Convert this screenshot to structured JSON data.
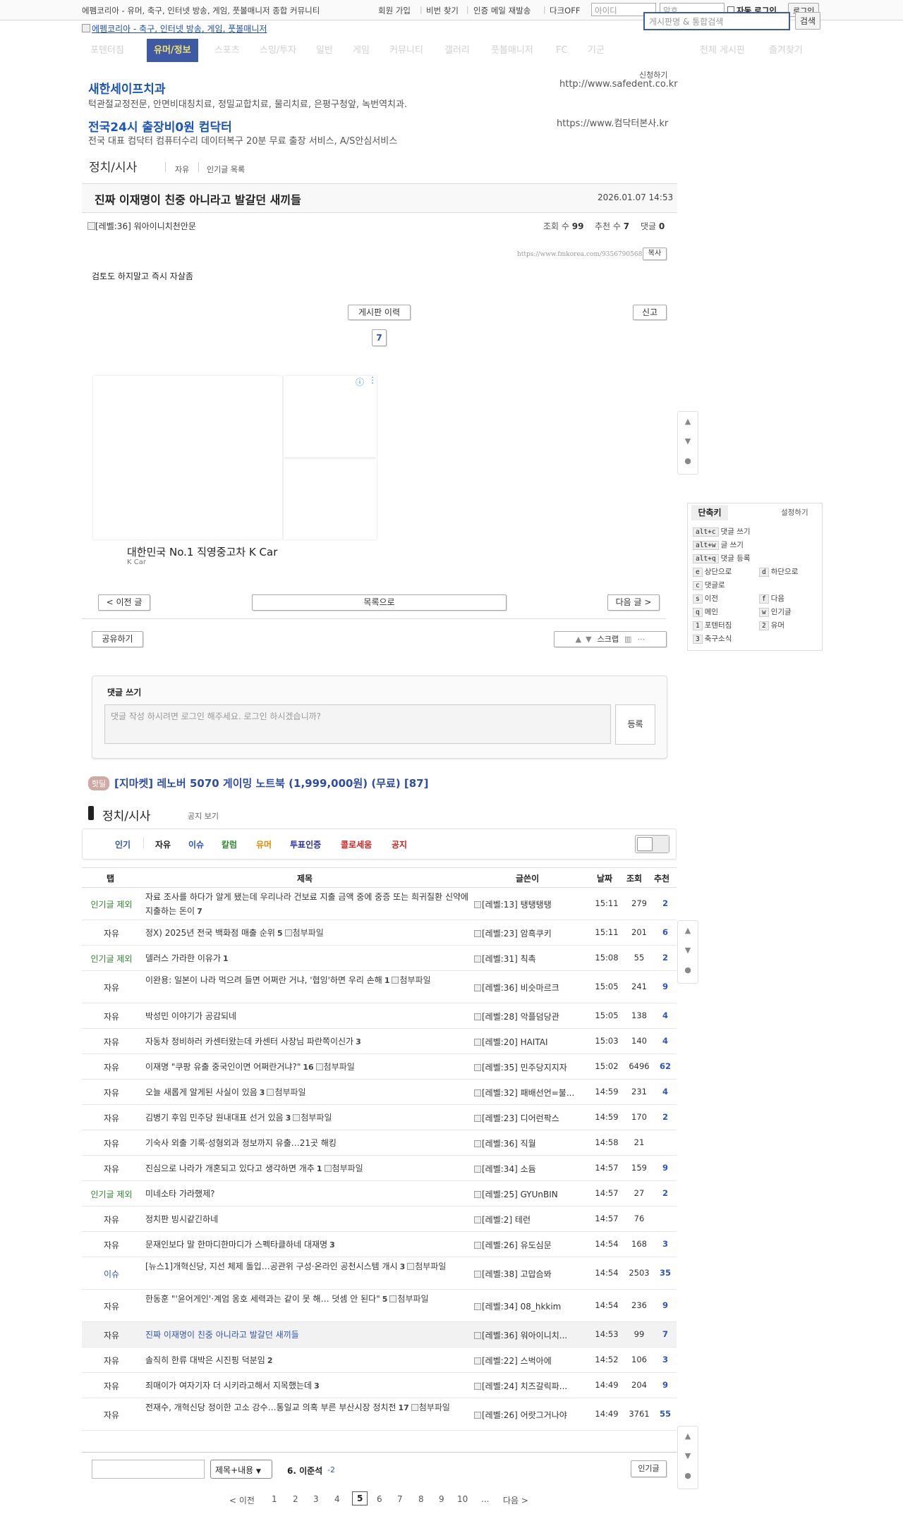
{
  "topbar": {
    "site_desc": "에펨코리아 - 유머, 축구, 인터넷 방송, 게임, 풋볼매니저 종합 커뮤니티",
    "links": [
      "회원 가입",
      "비번 찾기",
      "인증 메일 재발송",
      "다크OFF"
    ],
    "id_placeholder": "아이디",
    "pw_placeholder": "암호",
    "auto_login": "자동 로그인",
    "login": "로그인",
    "search_placeholder": "게시판명 & 통합검색",
    "search": "검색"
  },
  "logo_alt": "에펨코리아 - 축구, 인터넷 방송, 게임, 풋볼매니저",
  "nav": {
    "items": [
      "포텐터짐",
      "유머/정보",
      "스포츠",
      "스밍/투자",
      "일반",
      "게임",
      "커뮤니티",
      "갤러리",
      "풋볼매니저",
      "FC",
      "기군"
    ],
    "active": "유머/정보",
    "right": [
      "전체 게시판",
      "즐겨찾기"
    ]
  },
  "ads": {
    "apply": "신청하기",
    "items": [
      {
        "title": "새한세이프치과",
        "desc": "턱관절교정전문, 안면비대칭치료, 정밀교합치료, 물리치료, 은평구청앞, 녹번역치과.",
        "url": "http://www.safedent.co.kr"
      },
      {
        "title": "전국24시 출장비0원 컴닥터",
        "desc": "전국 대표 컴닥터 컴퓨터수리 데이터복구 20분 무료 출장 서비스, A/S안심서비스",
        "url": "https://www.컴닥터본사.kr"
      }
    ]
  },
  "board": {
    "title": "정치/시사",
    "subs": [
      "자유",
      "인기글 목록"
    ]
  },
  "article": {
    "title": "진짜 이재명이 친중 아니라고 발갈던 새끼들",
    "date": "2026.01.07 14:53",
    "author": "[레벨:36] 워아이니치천안문",
    "views_label": "조회 수",
    "views": "99",
    "votes_label": "추천 수",
    "votes": "7",
    "comments_label": "댓글",
    "comments": "0",
    "url": "https://www.fmkorea.com/9356790568",
    "copy": "복사",
    "body": "검토도 하지말고 즉시 자살좀",
    "history": "게시판 이력",
    "report": "신고",
    "vote_count": "7"
  },
  "sponsored": {
    "title": "대한민국 No.1 직영중고차 K Car",
    "brand": "K Car",
    "info_icon": "ⓘ"
  },
  "article_nav": {
    "prev": "< 이전 글",
    "list": "목록으로",
    "next": "다음 글 >",
    "share": "공유하기",
    "scrap": "스크랩"
  },
  "shortcuts": {
    "title": "단축키",
    "settings": "설정하기",
    "items": [
      {
        "k": "alt+c",
        "l": "댓글 쓰기"
      },
      {
        "k": "alt+w",
        "l": "글 쓰기"
      },
      {
        "k": "alt+q",
        "l": "댓글 등록"
      },
      {
        "k": "e",
        "l": "상단으로"
      },
      {
        "k": "d",
        "l": "하단으로"
      },
      {
        "k": "c",
        "l": "댓글로"
      },
      {
        "k": "s",
        "l": "이전"
      },
      {
        "k": "f",
        "l": "다음"
      },
      {
        "k": "q",
        "l": "메인"
      },
      {
        "k": "w",
        "l": "인기글"
      },
      {
        "k": "1",
        "l": "포텐터짐"
      },
      {
        "k": "2",
        "l": "유머"
      },
      {
        "k": "3",
        "l": "축구소식"
      }
    ]
  },
  "comment": {
    "title": "댓글 쓰기",
    "placeholder": "댓글 작성 하시려면 로그인 해주세요. 로그인 하시겠습니까?",
    "submit": "등록"
  },
  "hotdeal": {
    "badge": "핫딜",
    "text": "[지마켓] 레노버 5070 게이밍 노트북 (1,999,000원) (무료) [87]"
  },
  "list": {
    "title": "정치/시사",
    "notice_toggle": "공지 보기",
    "categories": [
      {
        "label": "인기",
        "color": "#2d55b5"
      },
      {
        "label": "자유",
        "color": "#222222"
      },
      {
        "label": "이슈",
        "color": "#2d55b5"
      },
      {
        "label": "칼럼",
        "color": "#2e8b2e"
      },
      {
        "label": "유머",
        "color": "#e08a00"
      },
      {
        "label": "투표인증",
        "color": "#2d2da0"
      },
      {
        "label": "콜로세움",
        "color": "#d02020"
      },
      {
        "label": "공지",
        "color": "#d02020"
      }
    ],
    "headers": [
      "탭",
      "제목",
      "글쓴이",
      "날짜",
      "조회",
      "추천"
    ],
    "attach_alt": "첨부파일",
    "rows": [
      {
        "cat": "인기글 제외",
        "title": "자료 조사를 하다가 알게 됐는데 우리나라 건보료 지출 금액 중에 중증 또는 희귀질환 신약에 지출하는 돈이",
        "cc": "7",
        "attach": false,
        "author": "[레벨:13] 탱탱탱탱",
        "time": "15:11",
        "views": "279",
        "votes": "2"
      },
      {
        "cat": "자유",
        "title": "정X) 2025년 전국 백화점 매출 순위",
        "cc": "5",
        "attach": true,
        "author": "[레벨:23] 암흑쿠키",
        "time": "15:11",
        "views": "201",
        "votes": "6"
      },
      {
        "cat": "인기글 제외",
        "title": "델러스 가라한 이유가",
        "cc": "1",
        "attach": false,
        "author": "[레벨:31] 칙촉",
        "time": "15:08",
        "views": "55",
        "votes": "2"
      },
      {
        "cat": "자유",
        "title": "이완용: 일본이 나라 먹으려 들면 어쩌란 거냐, '협잉'하면 우리 손해",
        "cc": "1",
        "attach": true,
        "author": "[레벨:36] 비슷마르크",
        "time": "15:05",
        "views": "241",
        "votes": "9"
      },
      {
        "cat": "자유",
        "title": "박성민 이야기가 공감되네",
        "cc": "",
        "attach": false,
        "author": "[레벨:28] 악플덤당관",
        "time": "15:05",
        "views": "138",
        "votes": "4"
      },
      {
        "cat": "자유",
        "title": "자동차 정비하러 카센터왔는데 카센터 사장님 파란쪽이신가",
        "cc": "3",
        "attach": false,
        "author": "[레벨:20] HAITAI",
        "time": "15:03",
        "views": "140",
        "votes": "4"
      },
      {
        "cat": "자유",
        "title": "이재명 \"쿠팡 유출 중국인이면 어쩌란거냐?\"",
        "cc": "16",
        "attach": true,
        "author": "[레벨:35] 민주당지지자",
        "time": "15:02",
        "views": "6496",
        "votes": "62"
      },
      {
        "cat": "자유",
        "title": "오늘 새롭게 알게된 사실이 있음",
        "cc": "3",
        "attach": true,
        "author": "[레벨:32] 패배선언=불...",
        "time": "14:59",
        "views": "231",
        "votes": "4"
      },
      {
        "cat": "자유",
        "title": "김병기 후임 민주당 원내대표 선거 있음",
        "cc": "3",
        "attach": true,
        "author": "[레벨:23] 디어런팍스",
        "time": "14:59",
        "views": "170",
        "votes": "2"
      },
      {
        "cat": "자유",
        "title": "기숙사 외출 기록·성형외과 정보까지 유출…21곳 해킹",
        "cc": "",
        "attach": false,
        "author": "[레벨:36] 직월",
        "time": "14:58",
        "views": "21",
        "votes": ""
      },
      {
        "cat": "자유",
        "title": "진심으로 나라가 개혼되고 있다고 생각하면 개추",
        "cc": "1",
        "attach": true,
        "author": "[레벨:34] 소듐",
        "time": "14:57",
        "views": "159",
        "votes": "9"
      },
      {
        "cat": "인기글 제외",
        "title": "미네소타 가라했제?",
        "cc": "",
        "attach": false,
        "author": "[레벨:25] GYUnBIN",
        "time": "14:57",
        "views": "27",
        "votes": "2"
      },
      {
        "cat": "자유",
        "title": "정치판 빙시같긴하네",
        "cc": "",
        "attach": false,
        "author": "[레벨:2] 테런",
        "time": "14:57",
        "views": "76",
        "votes": ""
      },
      {
        "cat": "자유",
        "title": "문재인보다 말 한마디한마디가 스펙타클하네 대재명",
        "cc": "3",
        "attach": false,
        "author": "[레벨:26] 유도심문",
        "time": "14:54",
        "views": "168",
        "votes": "3"
      },
      {
        "cat": "이슈",
        "title": "[뉴스1]개혁신당, 지선 체제 돌입…공관위 구성·온라인 공천시스템 개시",
        "cc": "3",
        "attach": true,
        "author": "[레벨:38] 고맙슴봐",
        "time": "14:54",
        "views": "2503",
        "votes": "35"
      },
      {
        "cat": "자유",
        "title": "한동훈 \"'윤어게인'·계엄 옹호 세력과는 같이 못 해… 덧셈 안 된다\"",
        "cc": "5",
        "attach": true,
        "author": "[레벨:34] 08_hkkim",
        "time": "14:54",
        "views": "236",
        "votes": "9"
      },
      {
        "cat": "자유",
        "title": "진짜 이재명이 친중 아니라고 발갈던 새끼들",
        "cc": "",
        "attach": false,
        "author": "[레벨:36] 워아이니치...",
        "time": "14:53",
        "views": "99",
        "votes": "7",
        "current": true
      },
      {
        "cat": "자유",
        "title": "솔직히 한류 대박은 시진핑 덕분임",
        "cc": "2",
        "attach": false,
        "author": "[레벨:22] 스벅아에",
        "time": "14:52",
        "views": "106",
        "votes": "3"
      },
      {
        "cat": "자유",
        "title": "죄매이가 여자기자 더 시키라고해서 지목했는데",
        "cc": "3",
        "attach": false,
        "author": "[레벨:24] 치즈갈릭파...",
        "time": "14:49",
        "views": "204",
        "votes": "9"
      },
      {
        "cat": "자유",
        "title": "전재수, 개혁신당 정이한 고소 강수…통일교 의혹 부른 부산시장 정치전",
        "cc": "17",
        "attach": true,
        "author": "[레벨:26] 어랏그거나야",
        "time": "14:49",
        "views": "3761",
        "votes": "55"
      }
    ]
  },
  "bottom": {
    "select": "제목+내용",
    "ranking": "6. 이준석",
    "ranking_change": "-2",
    "popular_btn": "인기글",
    "pages": [
      "< 이전",
      "1",
      "2",
      "3",
      "4",
      "5",
      "6",
      "7",
      "8",
      "9",
      "10",
      "...",
      "다음 >"
    ],
    "current_page": "5"
  }
}
